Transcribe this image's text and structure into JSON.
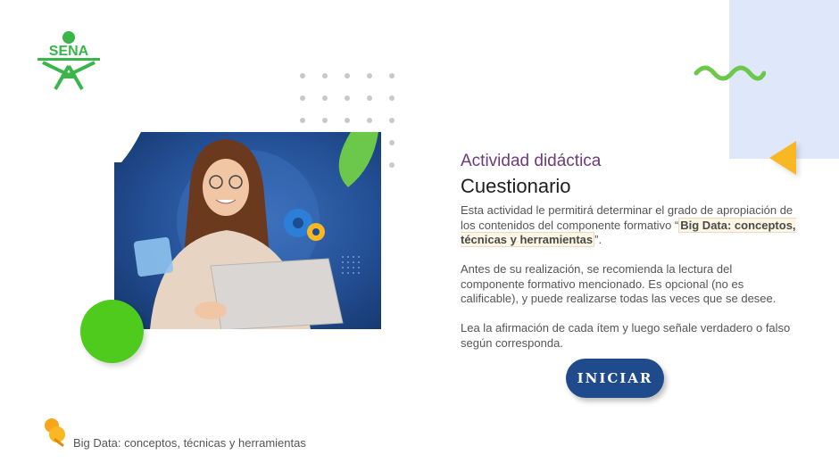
{
  "logo": {
    "text": "SENA",
    "color": "#39b54a"
  },
  "activity": {
    "kicker": "Actividad didáctica",
    "title": "Cuestionario",
    "p1_before": "Esta actividad le permitirá determinar el grado de apropiación de los contenidos del componente formativo “",
    "p1_highlight": "Big Data: conceptos, técnicas y herramientas",
    "p1_after": "”.",
    "p2": "Antes de su realización, se recomienda la lectura del componente formativo mencionado.  Es opcional (no es calificable), y puede realizarse todas las veces que se desee.",
    "p3": "Lea la afirmación de cada ítem y luego señale verdadero o falso según corresponda.",
    "start_label": "INICIAR"
  },
  "footer": {
    "course": "Big Data: conceptos, técnicas y herramientas",
    "icon": "pin-icon"
  },
  "colors": {
    "primary": "#1f4a8c",
    "accent_green": "#4fcb1e",
    "accent_orange": "#f9b723",
    "kicker": "#6c3b79",
    "panel": "#dfe7fb"
  }
}
